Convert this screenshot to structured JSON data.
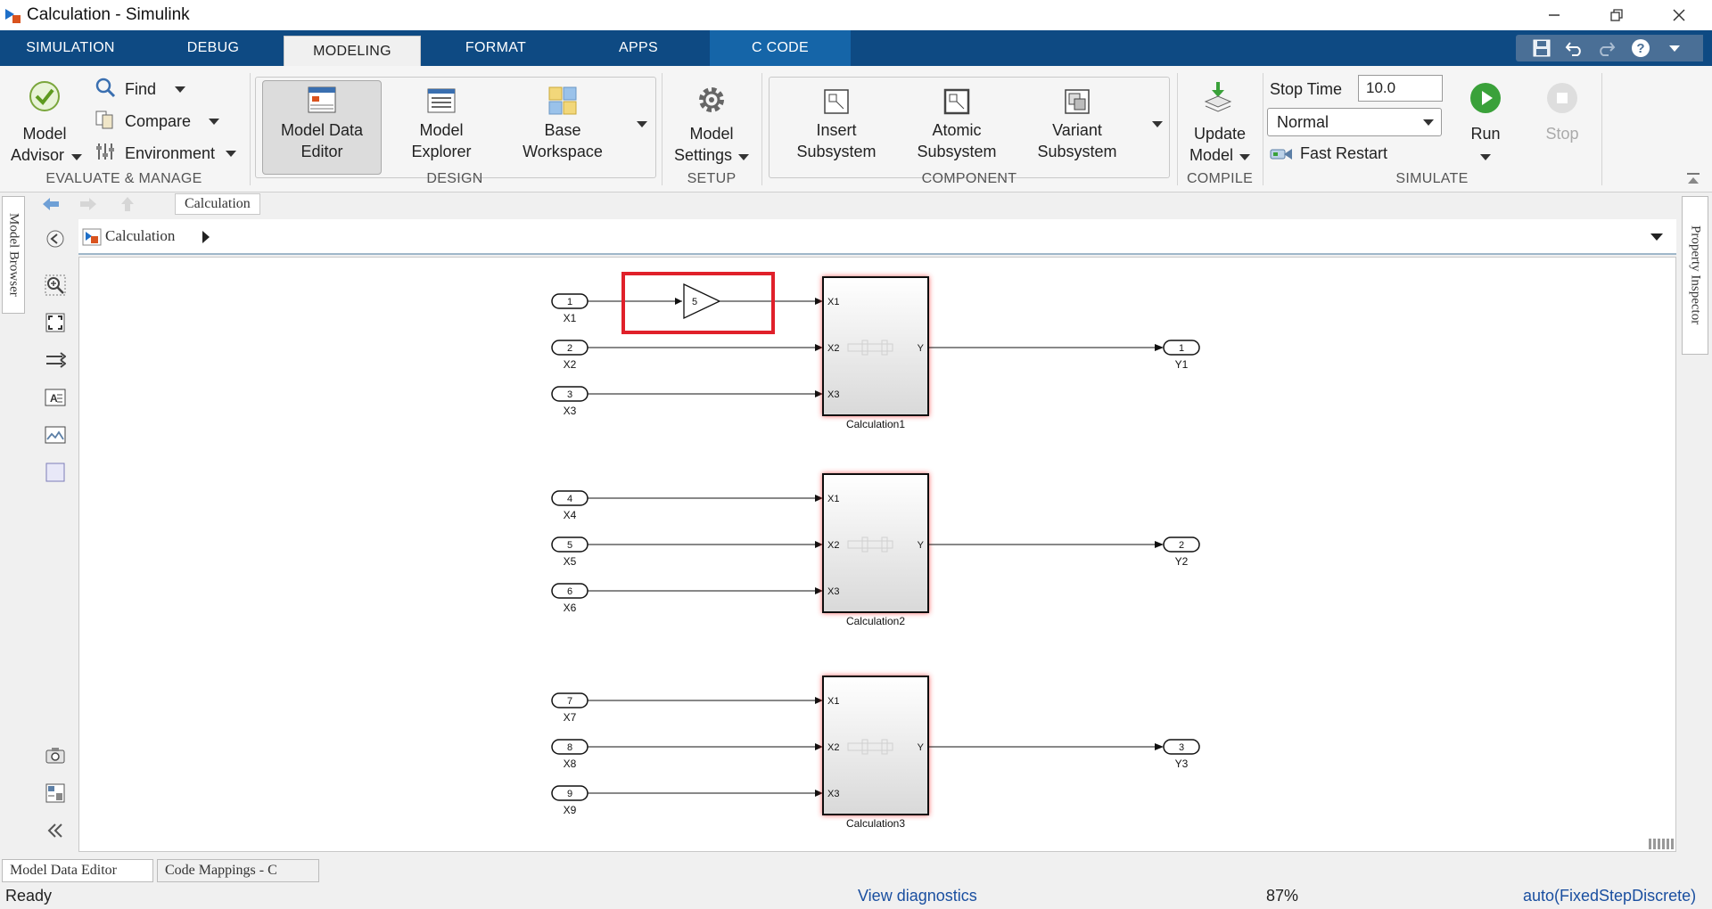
{
  "window": {
    "title": "Calculation - Simulink"
  },
  "tabs": [
    "SIMULATION",
    "DEBUG",
    "MODELING",
    "FORMAT",
    "APPS",
    "C CODE"
  ],
  "ribbon": {
    "model_advisor": [
      "Model",
      "Advisor"
    ],
    "find": "Find",
    "compare": "Compare",
    "environment": "Environment",
    "evaluate_group": "EVALUATE & MANAGE",
    "model_data_editor": [
      "Model Data",
      "Editor"
    ],
    "model_explorer": [
      "Model",
      "Explorer"
    ],
    "base_workspace": [
      "Base",
      "Workspace"
    ],
    "design_group": "DESIGN",
    "model_settings": [
      "Model",
      "Settings"
    ],
    "setup_group": "SETUP",
    "insert_subsystem": [
      "Insert",
      "Subsystem"
    ],
    "atomic_subsystem": [
      "Atomic",
      "Subsystem"
    ],
    "variant_subsystem": [
      "Variant",
      "Subsystem"
    ],
    "component_group": "COMPONENT",
    "update_model": [
      "Update",
      "Model"
    ],
    "compile_group": "COMPILE",
    "stop_time_label": "Stop Time",
    "stop_time_value": "10.0",
    "sim_mode": "Normal",
    "fast_restart": "Fast Restart",
    "run": "Run",
    "stop": "Stop",
    "simulate_group": "SIMULATE"
  },
  "side_tabs": {
    "left": "Model Browser",
    "right": "Property Inspector"
  },
  "explorer": {
    "tab": "Calculation",
    "address": "Calculation"
  },
  "diagram": {
    "gain_value": "5",
    "inports": [
      {
        "num": "1",
        "name": "X1"
      },
      {
        "num": "2",
        "name": "X2"
      },
      {
        "num": "3",
        "name": "X3"
      },
      {
        "num": "4",
        "name": "X4"
      },
      {
        "num": "5",
        "name": "X5"
      },
      {
        "num": "6",
        "name": "X6"
      },
      {
        "num": "7",
        "name": "X7"
      },
      {
        "num": "8",
        "name": "X8"
      },
      {
        "num": "9",
        "name": "X9"
      }
    ],
    "subsystems": [
      {
        "name": "Calculation1",
        "in_ports": [
          "X1",
          "X2",
          "X3"
        ],
        "out_port": "Y"
      },
      {
        "name": "Calculation2",
        "in_ports": [
          "X1",
          "X2",
          "X3"
        ],
        "out_port": "Y"
      },
      {
        "name": "Calculation3",
        "in_ports": [
          "X1",
          "X2",
          "X3"
        ],
        "out_port": "Y"
      }
    ],
    "outports": [
      {
        "num": "1",
        "name": "Y1"
      },
      {
        "num": "2",
        "name": "Y2"
      },
      {
        "num": "3",
        "name": "Y3"
      }
    ]
  },
  "bottom_tabs": [
    "Model Data Editor",
    "Code Mappings - C"
  ],
  "status": {
    "ready": "Ready",
    "diagnostics": "View diagnostics",
    "zoom": "87%",
    "solver": "auto(FixedStepDiscrete)"
  },
  "colors": {
    "tabbar": "#0e4a83",
    "highlight_box": "#e0202a",
    "link": "#1a4fa0"
  }
}
